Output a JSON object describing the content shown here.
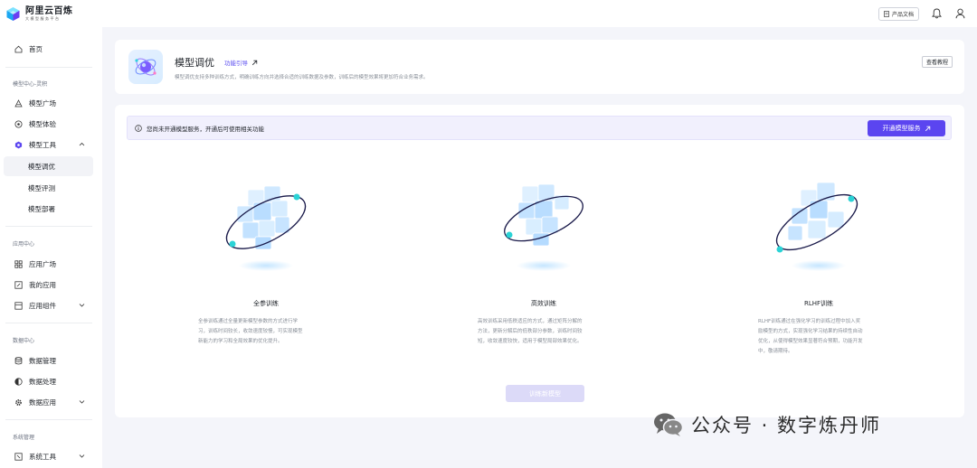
{
  "app": {
    "logo_name": "阿里云百炼",
    "logo_sub": "大模型服务平台",
    "docs_label": "产品文档"
  },
  "sidebar": {
    "home": "首页",
    "section_model": "模型中心-灵积",
    "model_square": "模型广场",
    "model_experience": "模型体验",
    "model_tools": "模型工具",
    "model_tune": "模型调优",
    "model_eval": "模型评测",
    "model_deploy": "模型部署",
    "section_app": "应用中心",
    "app_square": "应用广场",
    "my_apps": "我的应用",
    "app_components": "应用组件",
    "section_data": "数据中心",
    "data_manage": "数据管理",
    "data_process": "数据处理",
    "data_apps": "数据应用",
    "section_system": "系统管理",
    "system_tools": "系统工具"
  },
  "header": {
    "title": "模型调优",
    "guide_link": "功能引导",
    "description": "模型调优支持多种训练方式，明确训练方向并选择合适的训练数据及参数，训练后的模型效果将更加符合业务需求。",
    "tutorial_button": "查看教程"
  },
  "notice": {
    "text": "您尚未开通模型服务，开通后可使用相关功能",
    "button": "开通模型服务"
  },
  "options": [
    {
      "title": "全参训练",
      "desc_lines": [
        "全参训练通过全量更新模型参数的方式进行学",
        "习，训练时间较长，收敛速度较慢，可实现模型",
        "新能力的学习和全局效果的优化提升。"
      ]
    },
    {
      "title": "高效训练",
      "desc_lines": [
        "高效训练采用低秩适应的方式，通过矩阵分解的",
        "方法，更新分解后的低秩部分参数，训练时间较",
        "短，收敛速度较快，适用于模型局部效果优化。"
      ]
    },
    {
      "title": "RLHF训练",
      "desc_lines": [
        "RLHF训练通过在强化学习的训练过程中加入奖",
        "励模型的方式，实现强化学习结果的持续性自动",
        "优化，从使得模型效果显著符合预期，功能开发",
        "中，敬请期待。"
      ]
    }
  ],
  "start_button": "训练新模型",
  "watermark": "公众号 · 数字炼丹师",
  "colors": {
    "accent": "#5b45f0",
    "accent_disabled": "#dcdaf8",
    "notice_bg": "#f1f0fd",
    "page_bg": "#f4f5fa"
  }
}
